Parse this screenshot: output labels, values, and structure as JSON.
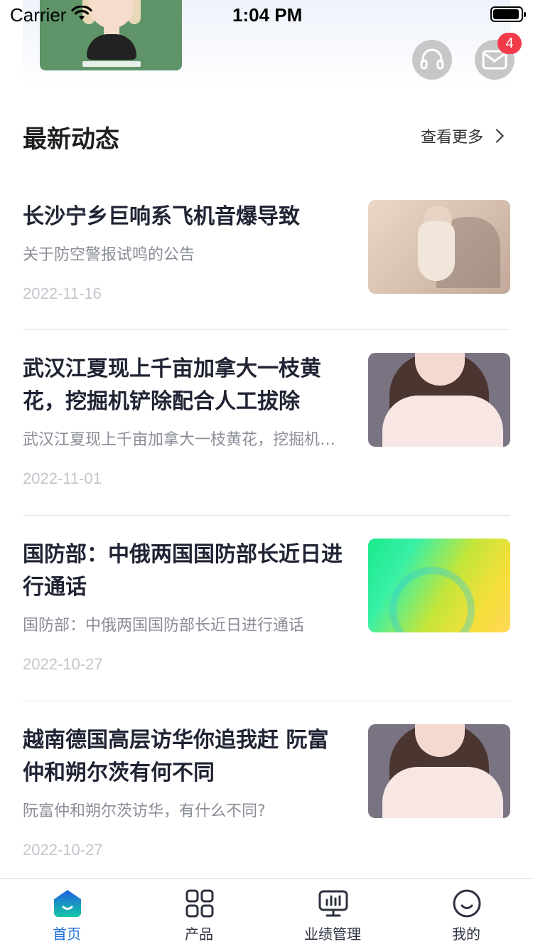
{
  "status_bar": {
    "carrier": "Carrier",
    "time": "1:04 PM"
  },
  "header": {
    "notification_count": "4",
    "icons": [
      "headset-icon",
      "mail-icon"
    ]
  },
  "section": {
    "title": "最新动态",
    "more_label": "查看更多"
  },
  "news": [
    {
      "title": "长沙宁乡巨响系飞机音爆导致",
      "summary": "关于防空警报试鸣的公告",
      "date": "2022-11-16",
      "thumb": "sage-painting"
    },
    {
      "title": "武汉江夏现上千亩加拿大一枝黄花，挖掘机铲除配合人工拔除",
      "summary": "武汉江夏现上千亩加拿大一枝黄花，挖掘机铲除配合人工拔除",
      "date": "2022-11-01",
      "thumb": "woman-portrait"
    },
    {
      "title": "国防部：中俄两国国防部长近日进行通话",
      "summary": "国防部：中俄两国国防部长近日进行通话",
      "date": "2022-10-27",
      "thumb": "green-gradient"
    },
    {
      "title": "越南德国高层访华你追我赶 阮富仲和朔尔茨有何不同",
      "summary": "阮富仲和朔尔茨访华，有什么不同?",
      "date": "2022-10-27",
      "thumb": "woman-portrait"
    }
  ],
  "tabbar": {
    "tabs": [
      {
        "label": "首页",
        "icon": "home-icon",
        "active": true
      },
      {
        "label": "产品",
        "icon": "grid-icon",
        "active": false
      },
      {
        "label": "业绩管理",
        "icon": "chart-monitor-icon",
        "active": false
      },
      {
        "label": "我的",
        "icon": "smile-profile-icon",
        "active": false
      }
    ],
    "active_color": "#1f6fd6"
  }
}
